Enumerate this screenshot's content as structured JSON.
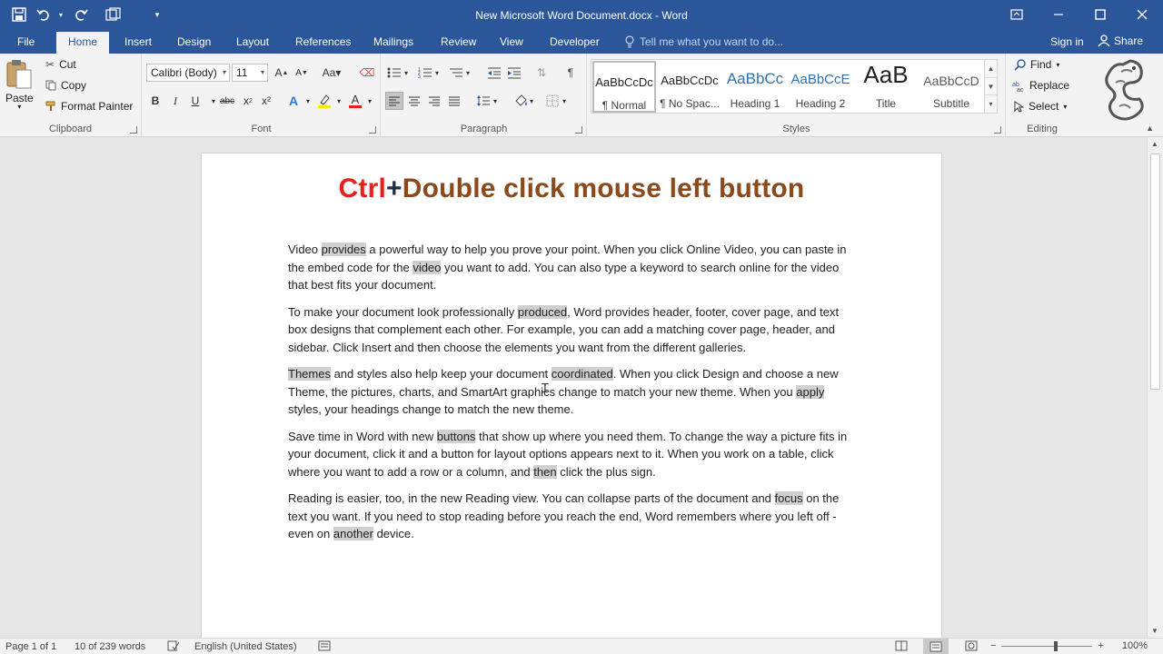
{
  "titlebar": {
    "title": "New Microsoft Word Document.docx - Word",
    "quick_access": [
      "save-icon",
      "undo-icon",
      "redo-icon",
      "touch-mode-icon",
      "customize-icon"
    ],
    "window_controls": [
      "ribbon-display-icon",
      "minimize-icon",
      "maximize-icon",
      "close-icon"
    ]
  },
  "tabs": {
    "items": [
      "File",
      "Home",
      "Insert",
      "Design",
      "Layout",
      "References",
      "Mailings",
      "Review",
      "View",
      "Developer"
    ],
    "active": "Home",
    "tell_me": "Tell me what you want to do...",
    "sign_in": "Sign in",
    "share": "Share"
  },
  "clipboard": {
    "label": "Clipboard",
    "paste": "Paste",
    "cut": "Cut",
    "copy": "Copy",
    "format_painter": "Format Painter"
  },
  "font": {
    "label": "Font",
    "family": "Calibri (Body)",
    "size": "11",
    "buttons": [
      "B",
      "I",
      "U",
      "abc",
      "x²",
      "A",
      "A"
    ]
  },
  "paragraph": {
    "label": "Paragraph"
  },
  "styles": {
    "label": "Styles",
    "items": [
      {
        "preview": "AaBbCcDc",
        "name": "¶ Normal",
        "selected": true
      },
      {
        "preview": "AaBbCcDc",
        "name": "¶ No Spac..."
      },
      {
        "preview": "AaBbCc",
        "name": "Heading 1",
        "color": "#2e74b5"
      },
      {
        "preview": "AaBbCcE",
        "name": "Heading 2",
        "color": "#2e74b5"
      },
      {
        "preview": "AaB",
        "name": "Title"
      },
      {
        "preview": "AaBbCcD",
        "name": "Subtitle",
        "color": "#5a5a5a"
      }
    ]
  },
  "editing": {
    "label": "Editing",
    "find": "Find",
    "replace": "Replace",
    "select": "Select"
  },
  "document": {
    "heading": {
      "part1": "Ctrl",
      "part2": "+",
      "part3": "Double click mouse left button"
    },
    "colors": {
      "ctrl": "#e8201a",
      "plus": "#1f2e45",
      "rest": "#8a4a1c"
    },
    "paragraphs": [
      [
        {
          "t": "Video "
        },
        {
          "t": "provides",
          "h": true
        },
        {
          "t": " a powerful way to help you prove your point. When you click Online Video, you can paste in the embed code for the "
        },
        {
          "t": "video",
          "h": true
        },
        {
          "t": " you want to add. You can also type a keyword to search online for the video that best fits your document."
        }
      ],
      [
        {
          "t": "To make your document look professionally "
        },
        {
          "t": "produced",
          "h": true
        },
        {
          "t": ", Word provides header, footer, cover page, and text box designs that complement each other. For example, you can add a matching cover page, header, and sidebar. Click Insert and then choose the elements you want from the different galleries."
        }
      ],
      [
        {
          "t": "Themes",
          "h": true
        },
        {
          "t": " and styles also help keep your document "
        },
        {
          "t": "coordinated",
          "h": true
        },
        {
          "t": ". When you click Design and choose a new Theme, the pictures, charts, and SmartArt graphics change to match your new theme. When you "
        },
        {
          "t": "apply",
          "h": true
        },
        {
          "t": " styles, your headings change to match the new theme."
        }
      ],
      [
        {
          "t": "Save time in Word with new "
        },
        {
          "t": "buttons",
          "h": true
        },
        {
          "t": " that show up where you need them. To change the way a picture fits in your document, click it and a button for layout options appears next to it. When you work on a table, click where you want to add a row or a column, and "
        },
        {
          "t": "then",
          "h": true
        },
        {
          "t": " click the plus sign."
        }
      ],
      [
        {
          "t": "Reading is easier, too, in the new Reading view. You can collapse parts of the document and "
        },
        {
          "t": "focus",
          "h": true
        },
        {
          "t": " on the text you want. If you need to stop reading before you reach the end, Word remembers where you left off - even on "
        },
        {
          "t": "another",
          "h": true
        },
        {
          "t": " device."
        }
      ]
    ]
  },
  "status": {
    "page": "Page 1 of 1",
    "words": "10 of 239 words",
    "language": "English (United States)",
    "zoom": "100%"
  }
}
